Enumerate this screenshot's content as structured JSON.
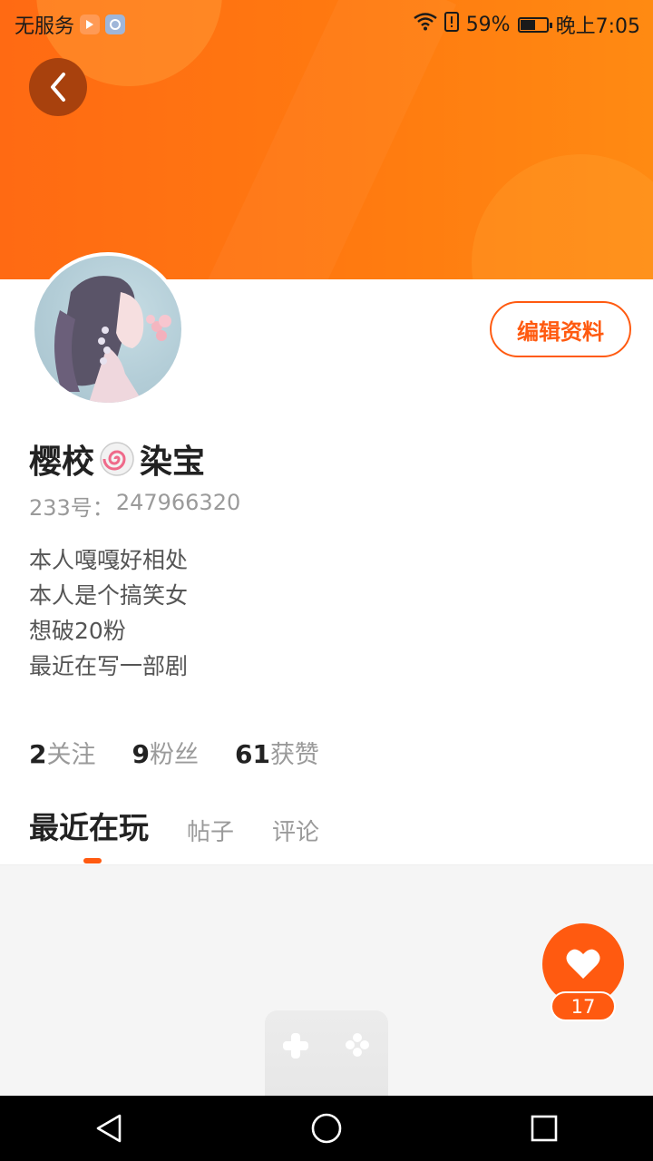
{
  "status_bar": {
    "carrier": "无服务",
    "battery_percent": "59%",
    "time": "晚上7:05"
  },
  "profile": {
    "name_part1": "樱校",
    "name_part2": "染宝",
    "id_label": "233号：",
    "id_value": "247966320",
    "edit_label": "编辑资料",
    "bio": [
      "本人嘎嘎好相处",
      "本人是个搞笑女",
      "想破20粉",
      "最近在写一部剧"
    ]
  },
  "stats": [
    {
      "num": "2",
      "label": "关注"
    },
    {
      "num": "9",
      "label": "粉丝"
    },
    {
      "num": "61",
      "label": "获赞"
    }
  ],
  "tabs": [
    {
      "label": "最近在玩",
      "active": true
    },
    {
      "label": "帖子",
      "active": false
    },
    {
      "label": "评论",
      "active": false
    }
  ],
  "like_fab": {
    "count": "17"
  },
  "colors": {
    "accent": "#ff5a10",
    "header": "#ff7a10",
    "text": "#222222",
    "secondary": "#9a9a9a"
  },
  "icons": [
    "back-icon",
    "wifi-icon",
    "alert-icon",
    "battery-icon",
    "heart-icon",
    "nav-back-icon",
    "nav-home-icon",
    "nav-recents-icon"
  ]
}
